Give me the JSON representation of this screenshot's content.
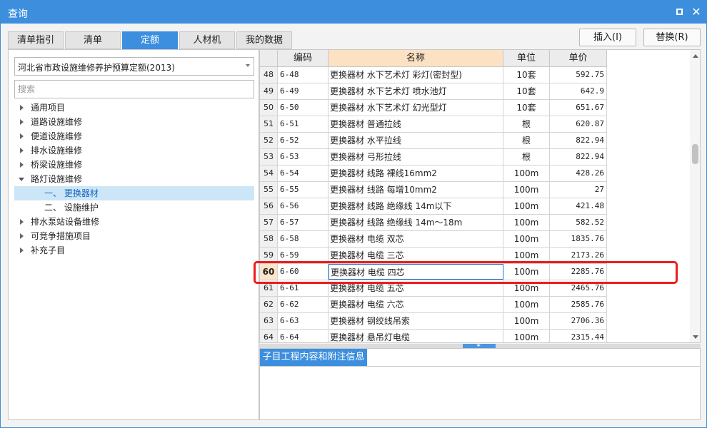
{
  "window": {
    "title": "查询"
  },
  "tabs": [
    {
      "label": "清单指引",
      "active": false
    },
    {
      "label": "清单",
      "active": false
    },
    {
      "label": "定额",
      "active": true
    },
    {
      "label": "人材机",
      "active": false
    },
    {
      "label": "我的数据",
      "active": false
    }
  ],
  "actions": {
    "insert_label": "插入(I)",
    "replace_label": "替换(R)"
  },
  "left": {
    "dropdown_value": "河北省市政设施维修养护预算定额(2013)",
    "search_placeholder": "搜索",
    "tree": [
      {
        "label": "通用项目",
        "level": 0,
        "expanded": false
      },
      {
        "label": "道路设施维修",
        "level": 0,
        "expanded": false
      },
      {
        "label": "便道设施维修",
        "level": 0,
        "expanded": false
      },
      {
        "label": "排水设施维修",
        "level": 0,
        "expanded": false
      },
      {
        "label": "桥梁设施维修",
        "level": 0,
        "expanded": false
      },
      {
        "label": "路灯设施维修",
        "level": 0,
        "expanded": true
      },
      {
        "label": "一、 更换器材",
        "level": 1,
        "selected": true
      },
      {
        "label": "二、 设施维护",
        "level": 1
      },
      {
        "label": "排水泵站设备维修",
        "level": 0,
        "expanded": false
      },
      {
        "label": "可竞争措施项目",
        "level": 0,
        "expanded": false
      },
      {
        "label": "补充子目",
        "level": 0,
        "expanded": false
      }
    ]
  },
  "grid": {
    "columns": [
      "编码",
      "名称",
      "单位",
      "单价"
    ],
    "rows": [
      {
        "num": "48",
        "code": "6-48",
        "name": "更换器材 水下艺术灯 彩灯(密封型)",
        "unit": "10套",
        "price": "592.75"
      },
      {
        "num": "49",
        "code": "6-49",
        "name": "更换器材 水下艺术灯 喷水池灯",
        "unit": "10套",
        "price": "642.9"
      },
      {
        "num": "50",
        "code": "6-50",
        "name": "更换器材 水下艺术灯 幻光型灯",
        "unit": "10套",
        "price": "651.67"
      },
      {
        "num": "51",
        "code": "6-51",
        "name": "更换器材 普通拉线",
        "unit": "根",
        "price": "620.87"
      },
      {
        "num": "52",
        "code": "6-52",
        "name": "更换器材 水平拉线",
        "unit": "根",
        "price": "822.94"
      },
      {
        "num": "53",
        "code": "6-53",
        "name": "更换器材 弓形拉线",
        "unit": "根",
        "price": "822.94"
      },
      {
        "num": "54",
        "code": "6-54",
        "name": "更换器材 线路 裸线16mm2",
        "unit": "100m",
        "price": "428.26"
      },
      {
        "num": "55",
        "code": "6-55",
        "name": "更换器材 线路 每增10mm2",
        "unit": "100m",
        "price": "27"
      },
      {
        "num": "56",
        "code": "6-56",
        "name": "更换器材 线路 绝缘线 14m以下",
        "unit": "100m",
        "price": "421.48"
      },
      {
        "num": "57",
        "code": "6-57",
        "name": "更换器材 线路 绝缘线 14m～18m",
        "unit": "100m",
        "price": "582.52"
      },
      {
        "num": "58",
        "code": "6-58",
        "name": "更换器材 电缆 双芯",
        "unit": "100m",
        "price": "1835.76"
      },
      {
        "num": "59",
        "code": "6-59",
        "name": "更换器材 电缆 三芯",
        "unit": "100m",
        "price": "2173.26"
      },
      {
        "num": "60",
        "code": "6-60",
        "name": "更换器材 电缆 四芯",
        "unit": "100m",
        "price": "2285.76",
        "current": true
      },
      {
        "num": "61",
        "code": "6-61",
        "name": "更换器材 电缆 五芯",
        "unit": "100m",
        "price": "2465.76"
      },
      {
        "num": "62",
        "code": "6-62",
        "name": "更换器材 电缆 六芯",
        "unit": "100m",
        "price": "2585.76"
      },
      {
        "num": "63",
        "code": "6-63",
        "name": "更换器材 钢绞线吊索",
        "unit": "100m",
        "price": "2706.36"
      },
      {
        "num": "64",
        "code": "6-64",
        "name": "更换器材 悬吊灯电缆",
        "unit": "100m",
        "price": "2315.44"
      }
    ]
  },
  "info_panel": {
    "tab_label": "子目工程内容和附注信息"
  },
  "colors": {
    "accent": "#3c8fde",
    "highlight": "#ee1b1b",
    "header_name_bg": "#fde1c3"
  }
}
